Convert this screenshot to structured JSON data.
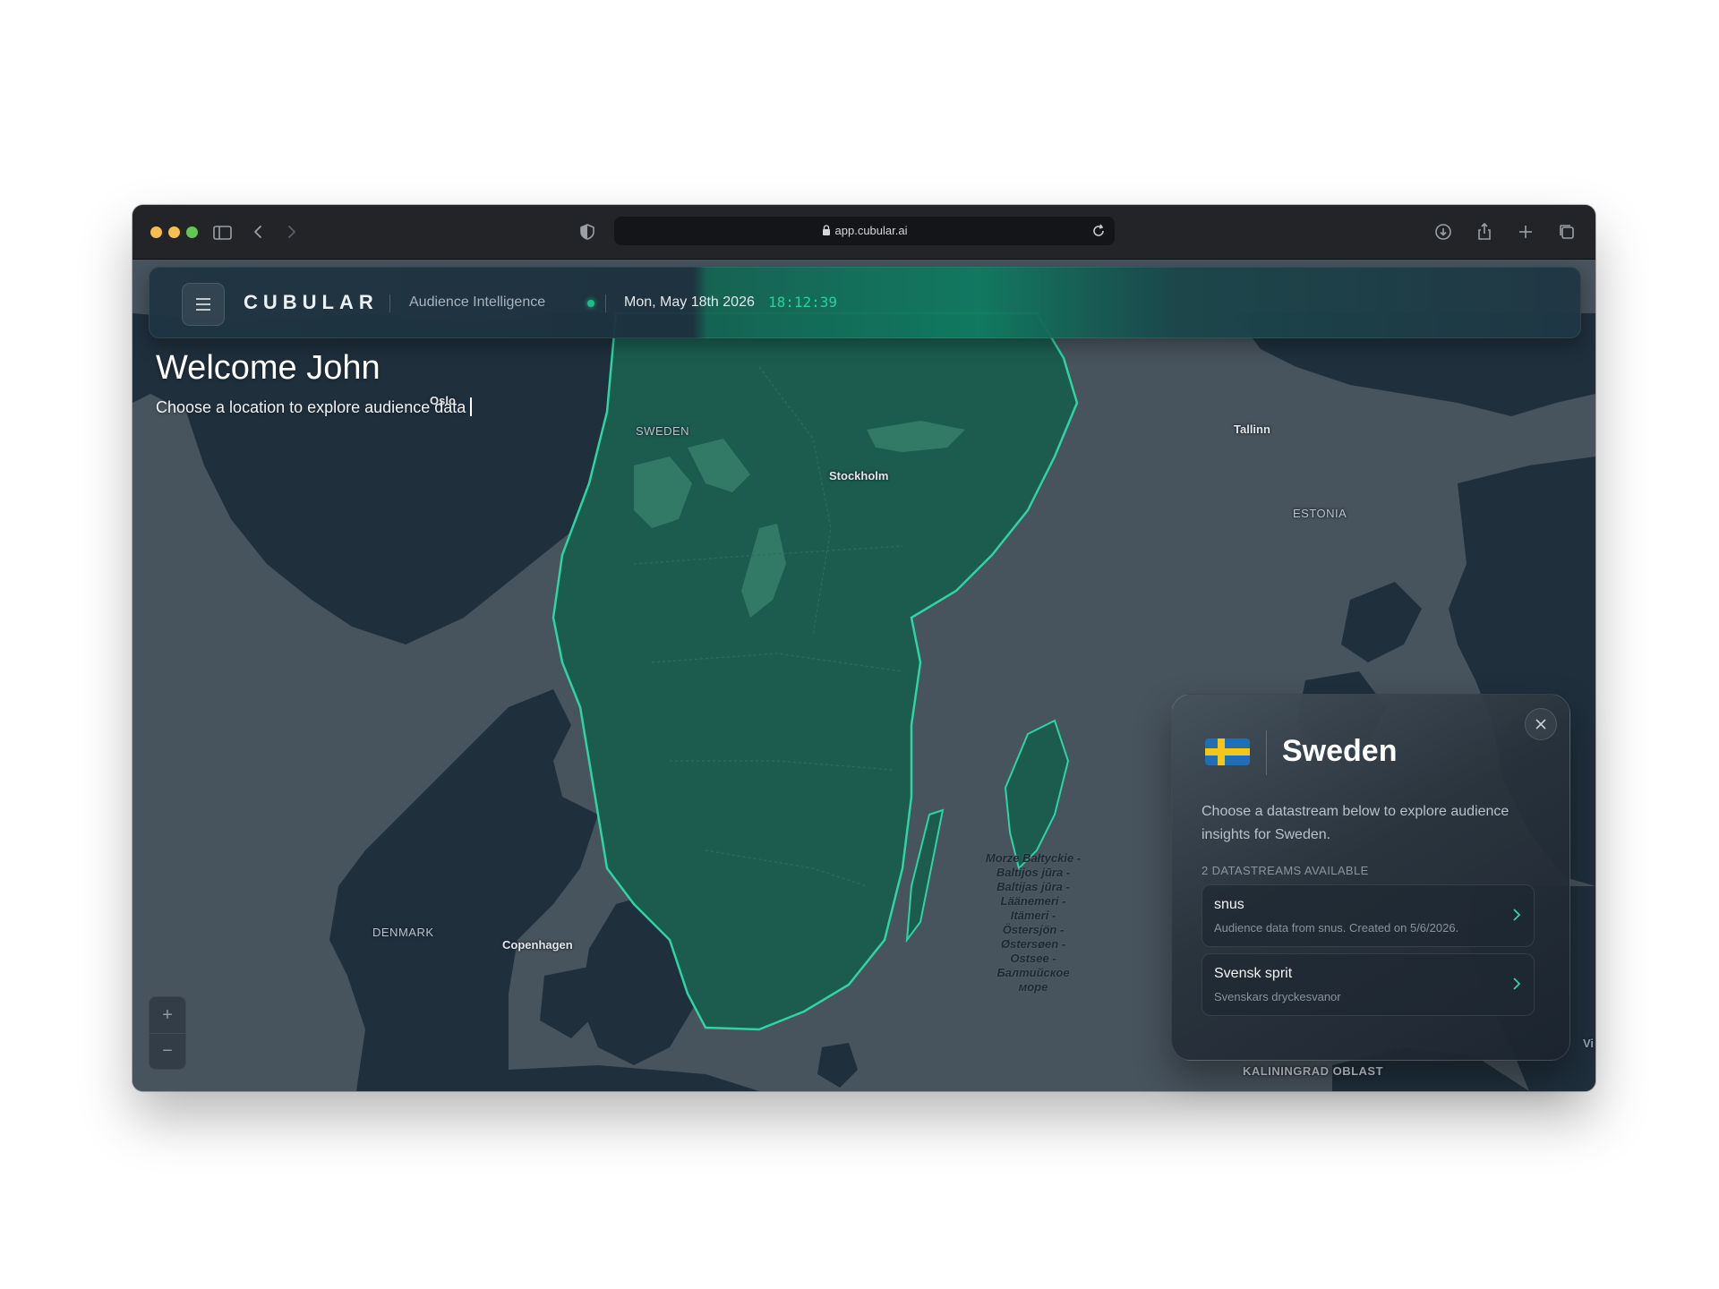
{
  "browser": {
    "url": "app.cubular.ai",
    "lights": {
      "close": "#f5bf4f",
      "minimize": "#f5bf4f",
      "zoom": "#62c655"
    }
  },
  "header": {
    "brand": "CUBULAR",
    "subtitle": "Audience Intelligence",
    "date": "Mon, May 18th 2026",
    "time": "18:12:39",
    "status_color": "#1ebd8a"
  },
  "welcome": {
    "title": "Welcome John",
    "subtitle": "Choose a location to explore audience data"
  },
  "map": {
    "labels": {
      "oslo": "Oslo",
      "sweden": "SWEDEN",
      "stockholm": "Stockholm",
      "tallinn": "Tallinn",
      "estonia": "ESTONIA",
      "denmark": "DENMARK",
      "copenhagen": "Copenhagen",
      "kaliningrad": "KALININGRAD OBLAST",
      "baltic_sea": "Morze Bałtyckie - Baltijos jūra - Baltijas jūra - Läänemeri - Itämeri - Östersjön - Østersøen - Ostsee - Балтийское море",
      "edge": "Vi"
    },
    "colors": {
      "water": "#47535d",
      "land": "#1f2f3c",
      "selected": "#1b5c4f",
      "selected_border": "#2fd4a3"
    },
    "zoom": {
      "in": "+",
      "out": "−"
    }
  },
  "panel": {
    "country": "Sweden",
    "description": "Choose a datastream below to explore audience insights for Sweden.",
    "count_label": "2 DATASTREAMS AVAILABLE",
    "datastreams": [
      {
        "name": "snus",
        "subtitle": "Audience data from snus. Created on 5/6/2026."
      },
      {
        "name": "Svensk sprit",
        "subtitle": "Svenskars dryckesvanor"
      }
    ]
  }
}
